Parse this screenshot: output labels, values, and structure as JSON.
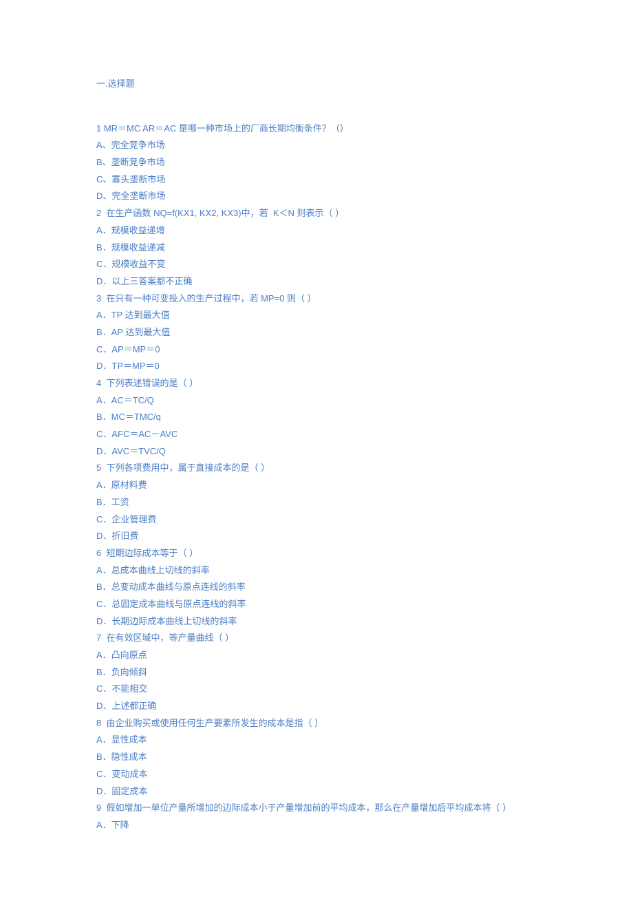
{
  "title": "一.选择题",
  "questions": [
    {
      "stem": "1 MR＝MC AR＝AC 是哪一种市场上的厂商长期均衡条件？（）",
      "options": [
        "A、完全竞争市场",
        "B、垄断竞争市场",
        "C、寡头垄断市场",
        "D、完全垄断市场"
      ]
    },
    {
      "stem": "2  在生产函数 NQ=f(KX1, KX2, KX3)中，若  K＜N 则表示（ ）",
      "options": [
        "A．规模收益递增",
        "B．规模收益递减",
        "C．规模收益不变",
        "D．以上三答案都不正确"
      ]
    },
    {
      "stem": "3  在只有一种可变投入的生产过程中，若 MP=0 则（ ）",
      "options": [
        "A．TP 达到最大值",
        "B．AP 达到最大值",
        "C．AP＝MP＝0",
        "D．TP＝MP＝0"
      ]
    },
    {
      "stem": "4  下列表述错误的是（ ）",
      "options": [
        "A．AC＝TC/Q",
        "B．MC＝TMC/q",
        "C．AFC＝AC－AVC",
        "D．AVC＝TVC/Q"
      ]
    },
    {
      "stem": "5  下列各项费用中，属于直接成本的是（ ）",
      "options": [
        "A．原材料费",
        "B．工资",
        "C．企业管理费",
        "D．折旧费"
      ]
    },
    {
      "stem": "6  短期边际成本等于（ ）",
      "options": [
        "A．总成本曲线上切线的斜率",
        "B．总变动成本曲线与原点连线的斜率",
        "C．总固定成本曲线与原点连线的斜率",
        "D．长期边际成本曲线上切线的斜率"
      ]
    },
    {
      "stem": "7  在有效区域中，等产量曲线（ ）",
      "options": [
        "A．凸向原点",
        "B．负向倾斜",
        "C．不能相交",
        "D．上述都正确"
      ]
    },
    {
      "stem": "8  由企业购买或使用任何生产要素所发生的成本是指（ ）",
      "options": [
        "A．显性成本",
        "B．隐性成本",
        "C．变动成本",
        "D．固定成本"
      ]
    },
    {
      "stem": "9  假如增加一单位产量所增加的边际成本小于产量增加前的平均成本，那么在产量增加后平均成本将（ ）",
      "options": [
        "A．下降"
      ]
    }
  ]
}
